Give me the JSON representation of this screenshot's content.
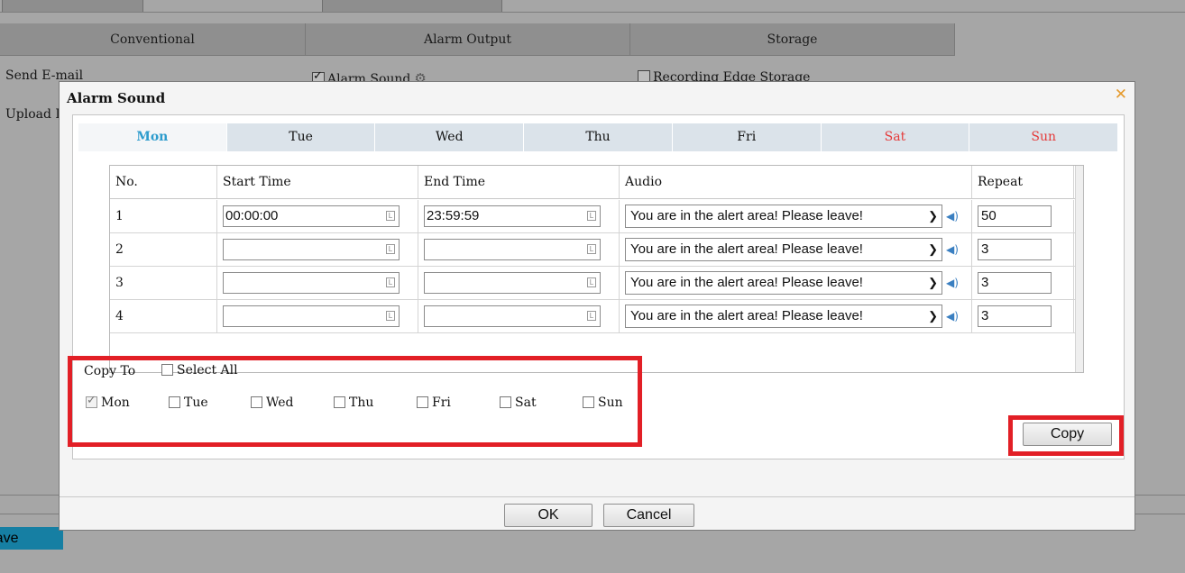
{
  "background": {
    "columns": [
      "Conventional",
      "Alarm Output",
      "Storage"
    ],
    "items": {
      "send_email": "Send E-mail",
      "upload": "Upload Im",
      "alarm_sound": "Alarm Sound",
      "recording_edge": "Recording Edge Storage"
    },
    "save_label": "Save"
  },
  "dialog": {
    "title": "Alarm Sound",
    "close_icon": "close-icon",
    "days": [
      "Mon",
      "Tue",
      "Wed",
      "Thu",
      "Fri",
      "Sat",
      "Sun"
    ],
    "active_day": "Mon",
    "table": {
      "headers": [
        "No.",
        "Start Time",
        "End Time",
        "Audio",
        "Repeat"
      ],
      "rows": [
        {
          "no": "1",
          "start": "00:00:00",
          "end": "23:59:59",
          "audio": "You are in the alert area! Please leave!",
          "repeat": "50"
        },
        {
          "no": "2",
          "start": "",
          "end": "",
          "audio": "You are in the alert area! Please leave!",
          "repeat": "3"
        },
        {
          "no": "3",
          "start": "",
          "end": "",
          "audio": "You are in the alert area! Please leave!",
          "repeat": "3"
        },
        {
          "no": "4",
          "start": "",
          "end": "",
          "audio": "You are in the alert area! Please leave!",
          "repeat": "3"
        }
      ]
    },
    "copy_to": {
      "label": "Copy To",
      "select_all": "Select All",
      "days": [
        "Mon",
        "Tue",
        "Wed",
        "Thu",
        "Fri",
        "Sat",
        "Sun"
      ],
      "checked": [
        "Mon"
      ]
    },
    "copy_button": "Copy",
    "ok_button": "OK",
    "cancel_button": "Cancel"
  },
  "colors": {
    "active_day": "#2d9ccd",
    "weekend_day": "#e53a3a",
    "highlight": "#e21f26",
    "close": "#e59a2c",
    "save": "#167fa3"
  }
}
